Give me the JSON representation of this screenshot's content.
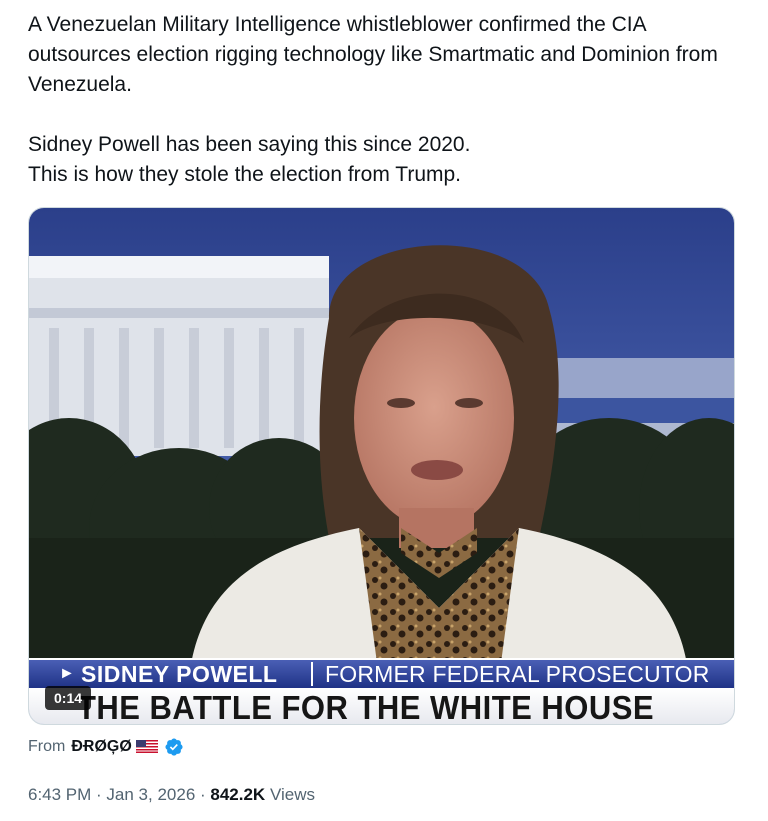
{
  "tweet": {
    "paragraphs": [
      "A Venezuelan Military Intelligence whistleblower confirmed the CIA outsources election rigging technology like Smartmatic and Dominion from Venezuela.",
      "Sidney Powell has been saying this since 2020.\nThis is how they stole the election from Trump."
    ]
  },
  "video": {
    "duration": "0:14",
    "chyron_arrow": "►",
    "chyron_name": "SIDNEY POWELL",
    "chyron_role": "FORMER FEDERAL PROSECUTOR",
    "chyron_headline": "THE BATTLE FOR THE WHITE HOUSE"
  },
  "attribution": {
    "from_label": "From",
    "user": "ĐɌØĢØ",
    "flag_icon": "us-flag-icon",
    "verified_icon": "verified-badge-icon",
    "verified_color": "#1d9bf0"
  },
  "meta": {
    "time": "6:43 PM",
    "separator": " · ",
    "date": "Jan 3, 2026",
    "views_count": "842.2K",
    "views_label": "Views"
  },
  "colors": {
    "text": "#0f1419",
    "secondary": "#536471",
    "chyron_blue": "#1f3286"
  }
}
